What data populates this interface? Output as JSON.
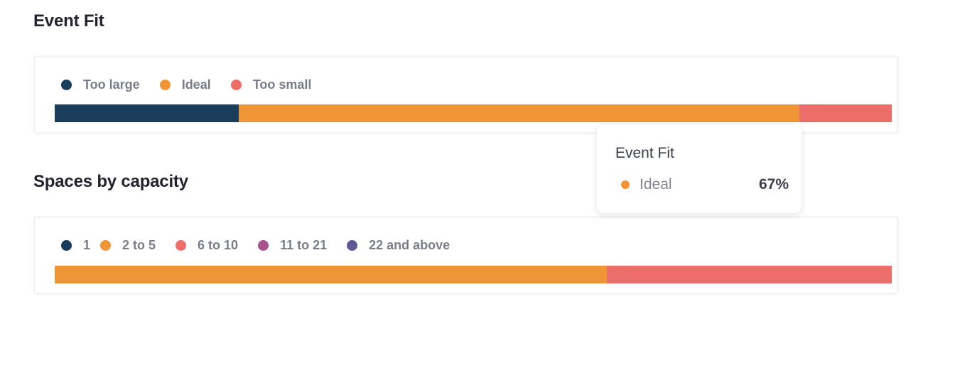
{
  "sections": [
    {
      "title": "Event Fit"
    },
    {
      "title": "Spaces by capacity"
    }
  ],
  "chart_data": [
    {
      "type": "bar",
      "orientation": "horizontal-stacked-100",
      "title": "Event Fit",
      "legend": "top-left",
      "series": [
        {
          "name": "Too large",
          "value": 22,
          "color": "#1a3d5c"
        },
        {
          "name": "Ideal",
          "value": 67,
          "color": "#f09536"
        },
        {
          "name": "Too small",
          "value": 11,
          "color": "#ed6d68"
        }
      ],
      "unit": "%"
    },
    {
      "type": "bar",
      "orientation": "horizontal-stacked-100",
      "title": "Spaces by capacity",
      "legend": "top-left",
      "series": [
        {
          "name": "1",
          "value": 0,
          "color": "#1a3d5c"
        },
        {
          "name": "2 to 5",
          "value": 66,
          "color": "#f09536"
        },
        {
          "name": "6 to 10",
          "value": 34,
          "color": "#ed6d68"
        },
        {
          "name": "11 to 21",
          "value": 0,
          "color": "#a8538e"
        },
        {
          "name": "22 and above",
          "value": 0,
          "color": "#5f5a94"
        }
      ],
      "unit": "%"
    }
  ],
  "tooltip": {
    "title": "Event Fit",
    "label": "Ideal",
    "value": "67%",
    "color": "#f09536"
  }
}
